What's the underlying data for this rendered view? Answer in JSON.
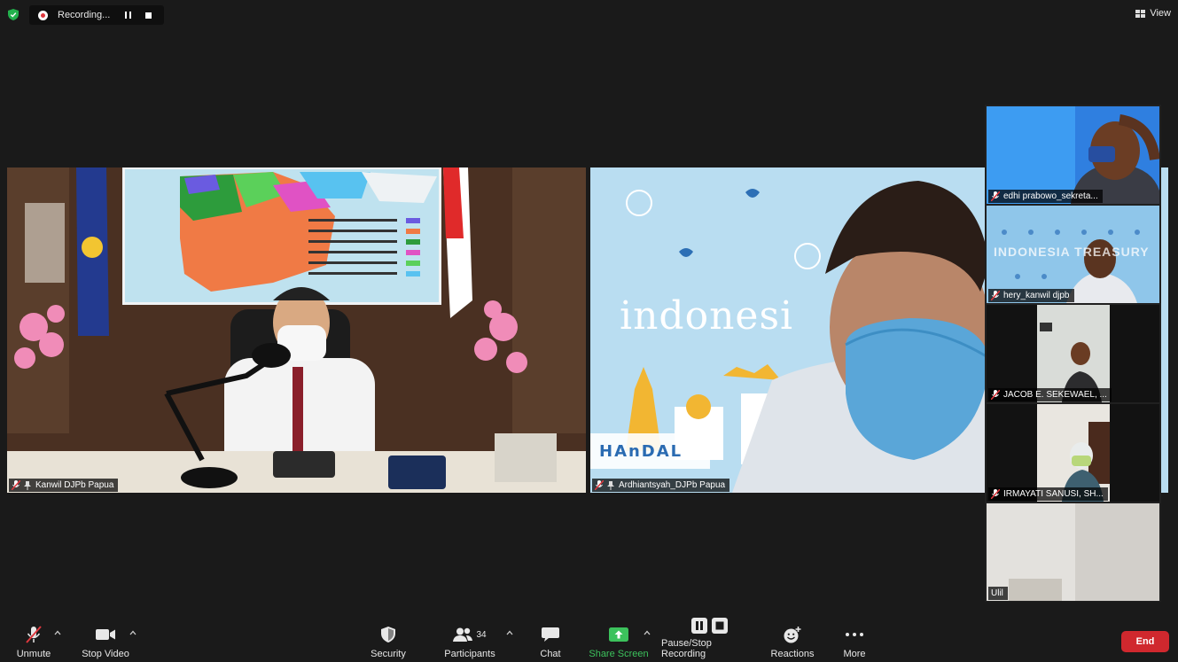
{
  "recording": {
    "label": "Recording...",
    "pause_icon": "pause-icon",
    "stop_icon": "stop-icon"
  },
  "view": {
    "label": "View"
  },
  "main_tiles": [
    {
      "name": "Kanwil DJPb Papua"
    },
    {
      "name": "Ardhiantsyah_DJPb Papua"
    }
  ],
  "backdrop_text": {
    "word": "indonesi",
    "banner": "HAnDAL",
    "treasury": "INDONESIA TREASURY"
  },
  "side_tiles": [
    {
      "name": "edhi prabowo_sekreta..."
    },
    {
      "name": "hery_kanwil djpb"
    },
    {
      "name": "JACOB E. SEKEWAEL, ..."
    },
    {
      "name": "IRMAYATI SANUSI, SH..."
    },
    {
      "name": "Ulil"
    }
  ],
  "toolbar": {
    "unmute": "Unmute",
    "stop_video": "Stop Video",
    "security": "Security",
    "participants": "Participants",
    "participants_count": "34",
    "chat": "Chat",
    "share_screen": "Share Screen",
    "pause_stop_recording": "Pause/Stop Recording",
    "reactions": "Reactions",
    "more": "More",
    "end": "End"
  },
  "colors": {
    "accent_green": "#3cc25c",
    "end_red": "#d0282e",
    "rec_red": "#e0383e",
    "background": "#1a1a1a"
  }
}
